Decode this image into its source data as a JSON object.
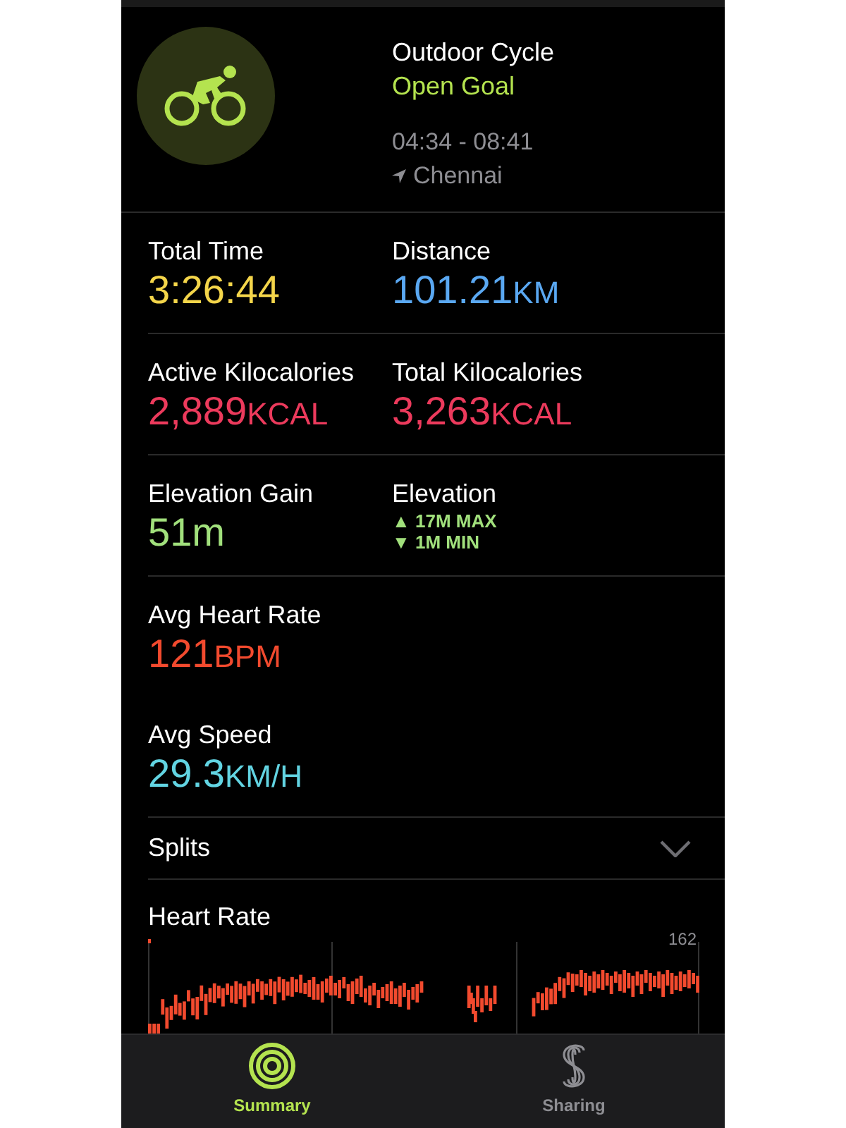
{
  "header": {
    "title": "Outdoor Cycle",
    "goal": "Open Goal",
    "time_range": "04:34 - 08:41",
    "location": "Chennai"
  },
  "sections": [
    [
      {
        "items": [
          {
            "label": "Total Time",
            "value": "3:26:44",
            "color": "#f4d54a"
          },
          {
            "label": "Distance",
            "value": "101.21",
            "unit": "KM",
            "color": "#5aa8f2"
          }
        ]
      }
    ],
    [
      {
        "items": [
          {
            "label": "Active Kilocalories",
            "value": "2,889",
            "unit": "KCAL",
            "color": "#ec3a5c"
          },
          {
            "label": "Total Kilocalories",
            "value": "3,263",
            "unit": "KCAL",
            "color": "#ec3a5c"
          }
        ]
      }
    ],
    [
      {
        "items": [
          {
            "label": "Elevation Gain",
            "value": "51m",
            "color": "#a1e07c"
          },
          {
            "kind": "range",
            "label": "Elevation",
            "lines": [
              "▲ 17M MAX",
              "▼ 1M MIN"
            ],
            "color": "#a1e07c"
          }
        ]
      }
    ],
    [
      {
        "items": [
          {
            "label": "Avg Heart Rate",
            "value": "121",
            "unit": "BPM",
            "color": "#f24a2e"
          }
        ]
      },
      {
        "items": [
          {
            "label": "Avg Speed",
            "value": "29.3",
            "unit": "KM/H",
            "color": "#62d4e2"
          }
        ]
      }
    ]
  ],
  "splits": {
    "label": "Splits",
    "expanded": false
  },
  "heart_rate": {
    "title": "Heart Rate",
    "max_label": "162"
  },
  "tab_bar": [
    {
      "kind": "rings",
      "label": "Summary",
      "selected": true
    },
    {
      "kind": "sharing",
      "label": "Sharing",
      "selected": false
    }
  ]
}
